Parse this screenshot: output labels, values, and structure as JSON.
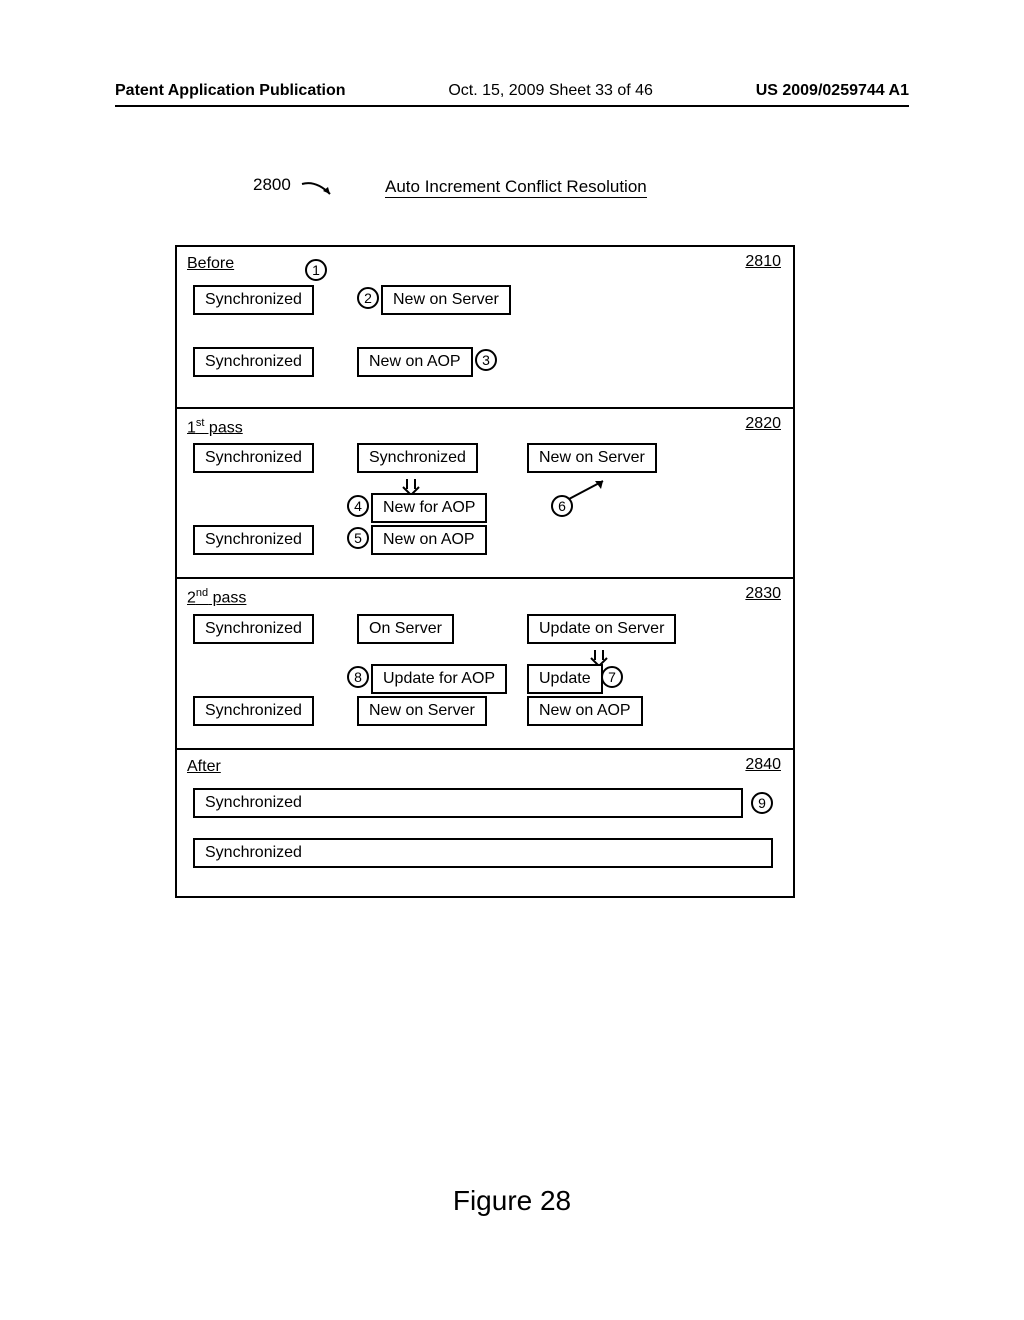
{
  "header": {
    "left": "Patent Application Publication",
    "center": "Oct. 15, 2009  Sheet 33 of 46",
    "right": "US 2009/0259744 A1"
  },
  "figure": {
    "number_label": "2800",
    "title": "Auto Increment Conflict Resolution",
    "caption": "Figure 28"
  },
  "sections": {
    "before": {
      "title": "Before",
      "ref": "2810",
      "row1": {
        "col1": "Synchronized",
        "col2": "New on Server"
      },
      "row2": {
        "col1": "Synchronized",
        "col2": "New on AOP"
      },
      "callouts": {
        "c1": "1",
        "c2": "2",
        "c3": "3"
      }
    },
    "pass1": {
      "title_prefix": "1",
      "title_sup": "st",
      "title_suffix": " pass",
      "ref": "2820",
      "row1": {
        "col1": "Synchronized",
        "col2": "Synchronized",
        "col3": "New on Server"
      },
      "mid": {
        "col2": "New for AOP"
      },
      "row2": {
        "col1": "Synchronized",
        "col2": "New on AOP"
      },
      "callouts": {
        "c4": "4",
        "c5": "5",
        "c6": "6"
      }
    },
    "pass2": {
      "title_prefix": "2",
      "title_sup": "nd",
      "title_suffix": " pass",
      "ref": "2830",
      "row1": {
        "col1": "Synchronized",
        "col2": "On Server",
        "col3": "Update on Server"
      },
      "mid": {
        "col2": "Update for AOP",
        "col3": "Update"
      },
      "row2": {
        "col1": "Synchronized",
        "col2": "New on Server",
        "col3": "New on AOP"
      },
      "callouts": {
        "c7": "7",
        "c8": "8"
      }
    },
    "after": {
      "title": "After",
      "ref": "2840",
      "row1": {
        "col1": "Synchronized"
      },
      "row2": {
        "col1": "Synchronized"
      },
      "callouts": {
        "c9": "9"
      }
    }
  }
}
